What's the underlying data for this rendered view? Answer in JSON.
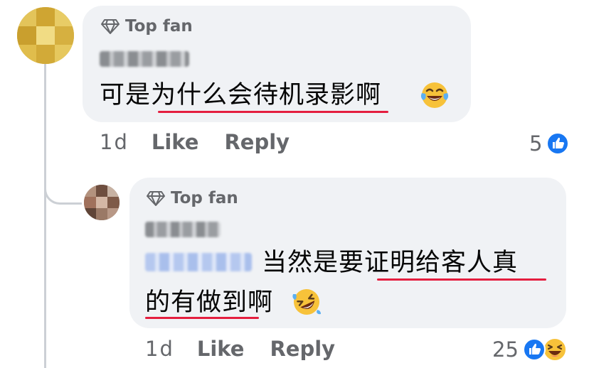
{
  "comments": [
    {
      "badge": "Top fan",
      "author": "Cxx Dxx",
      "text": "可是为什么会待机录影啊",
      "time": "1d",
      "like_label": "Like",
      "reply_label": "Reply",
      "reaction_count": "5",
      "reactions": [
        "like-icon"
      ],
      "emoji": "laughing-tears-emoji"
    },
    {
      "badge": "Top fan",
      "author": "Ixx Txx",
      "mention": "Cxx Cxx",
      "text_line1": "当然是要证明给客人真",
      "text_line2": "的有做到啊",
      "time": "1d",
      "like_label": "Like",
      "reply_label": "Reply",
      "reaction_count": "25",
      "reactions": [
        "like-icon",
        "haha-icon"
      ],
      "emoji": "rolling-laughing-emoji"
    }
  ],
  "colors": {
    "bubble": "#f0f2f5",
    "meta_text": "#65676b",
    "underline": "#e41e3f",
    "like_blue": "#1877f2",
    "thread_line": "#ccd0d5"
  }
}
